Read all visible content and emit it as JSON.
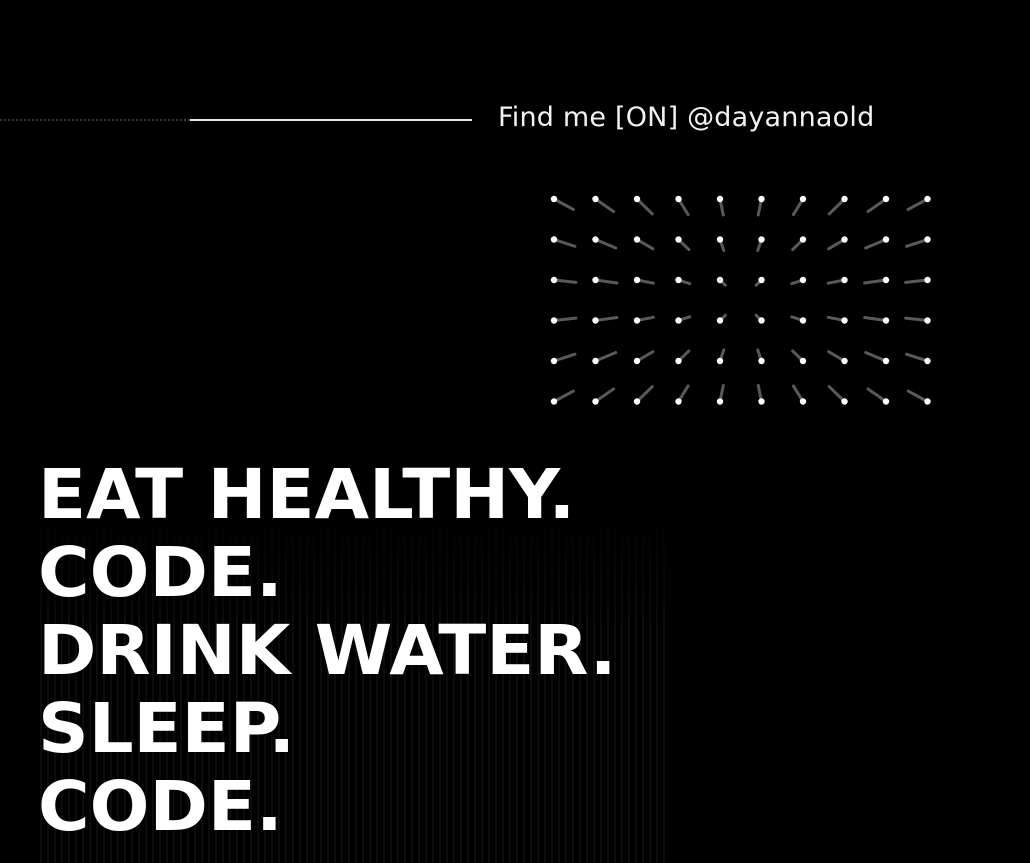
{
  "header": {
    "handle_text": "Find me [ON] @dayannaold"
  },
  "headline": {
    "lines": [
      "EAT HEALTHY.",
      "CODE.",
      "DRINK WATER.",
      "SLEEP.",
      "CODE."
    ]
  },
  "decor": {
    "dot_grid_icon": "dot-grid-pattern",
    "text_color": "#ffffff",
    "background_color": "#000000"
  }
}
